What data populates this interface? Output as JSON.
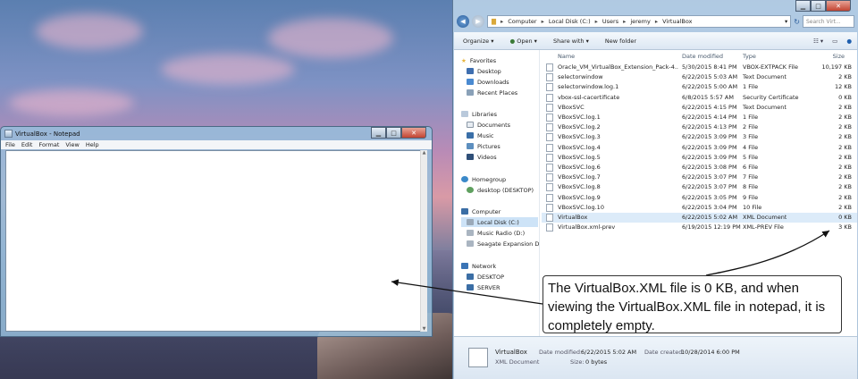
{
  "notepad": {
    "title": "VirtualBox - Notepad",
    "menu": [
      "File",
      "Edit",
      "Format",
      "View",
      "Help"
    ],
    "content": ""
  },
  "explorer": {
    "breadcrumb": [
      "Computer",
      "Local Disk (C:)",
      "Users",
      "jeremy",
      "VirtualBox"
    ],
    "search_placeholder": "Search Virt...",
    "toolbar": {
      "organize": "Organize",
      "open": "Open",
      "share": "Share with",
      "new_folder": "New folder"
    },
    "nav": {
      "favorites": "Favorites",
      "desktop": "Desktop",
      "downloads": "Downloads",
      "recent": "Recent Places",
      "libraries": "Libraries",
      "documents": "Documents",
      "music": "Music",
      "pictures": "Pictures",
      "videos": "Videos",
      "homegroup": "Homegroup",
      "desktop_user": "desktop (DESKTOP)",
      "computer": "Computer",
      "local_disk": "Local Disk (C:)",
      "music_radio": "Music Radio (D:)",
      "seagate": "Seagate Expansion D",
      "network": "Network",
      "desktop_net": "DESKTOP",
      "server": "SERVER"
    },
    "columns": {
      "name": "Name",
      "date": "Date modified",
      "type": "Type",
      "size": "Size"
    },
    "files": [
      {
        "name": "Oracle_VM_VirtualBox_Extension_Pack-4....",
        "date": "5/30/2015 8:41 PM",
        "type": "VBOX-EXTPACK File",
        "size": "10,197 KB"
      },
      {
        "name": "selectorwindow",
        "date": "6/22/2015 5:03 AM",
        "type": "Text Document",
        "size": "2 KB"
      },
      {
        "name": "selectorwindow.log.1",
        "date": "6/22/2015 5:00 AM",
        "type": "1 File",
        "size": "12 KB"
      },
      {
        "name": "vbox-ssl-cacertificate",
        "date": "6/8/2015 5:57 AM",
        "type": "Security Certificate",
        "size": "0 KB"
      },
      {
        "name": "VBoxSVC",
        "date": "6/22/2015 4:15 PM",
        "type": "Text Document",
        "size": "2 KB"
      },
      {
        "name": "VBoxSVC.log.1",
        "date": "6/22/2015 4:14 PM",
        "type": "1 File",
        "size": "2 KB"
      },
      {
        "name": "VBoxSVC.log.2",
        "date": "6/22/2015 4:13 PM",
        "type": "2 File",
        "size": "2 KB"
      },
      {
        "name": "VBoxSVC.log.3",
        "date": "6/22/2015 3:09 PM",
        "type": "3 File",
        "size": "2 KB"
      },
      {
        "name": "VBoxSVC.log.4",
        "date": "6/22/2015 3:09 PM",
        "type": "4 File",
        "size": "2 KB"
      },
      {
        "name": "VBoxSVC.log.5",
        "date": "6/22/2015 3:09 PM",
        "type": "5 File",
        "size": "2 KB"
      },
      {
        "name": "VBoxSVC.log.6",
        "date": "6/22/2015 3:08 PM",
        "type": "6 File",
        "size": "2 KB"
      },
      {
        "name": "VBoxSVC.log.7",
        "date": "6/22/2015 3:07 PM",
        "type": "7 File",
        "size": "2 KB"
      },
      {
        "name": "VBoxSVC.log.8",
        "date": "6/22/2015 3:07 PM",
        "type": "8 File",
        "size": "2 KB"
      },
      {
        "name": "VBoxSVC.log.9",
        "date": "6/22/2015 3:05 PM",
        "type": "9 File",
        "size": "2 KB"
      },
      {
        "name": "VBoxSVC.log.10",
        "date": "6/22/2015 3:04 PM",
        "type": "10 File",
        "size": "2 KB"
      },
      {
        "name": "VirtualBox",
        "date": "6/22/2015 5:02 AM",
        "type": "XML Document",
        "size": "0 KB"
      },
      {
        "name": "VirtualBox.xml-prev",
        "date": "6/19/2015 12:19 PM",
        "type": "XML-PREV File",
        "size": "3 KB"
      }
    ],
    "details": {
      "name": "VirtualBox",
      "type": "XML Document",
      "modified_label": "Date modified:",
      "modified": "6/22/2015 5:02 AM",
      "created_label": "Date created:",
      "created": "10/28/2014 6:00 PM",
      "size_label": "Size:",
      "size": "0 bytes"
    }
  },
  "annotation": "The VirtualBox.XML file is 0 KB, and when viewing the VirtualBox.XML file in notepad, it is completely empty."
}
